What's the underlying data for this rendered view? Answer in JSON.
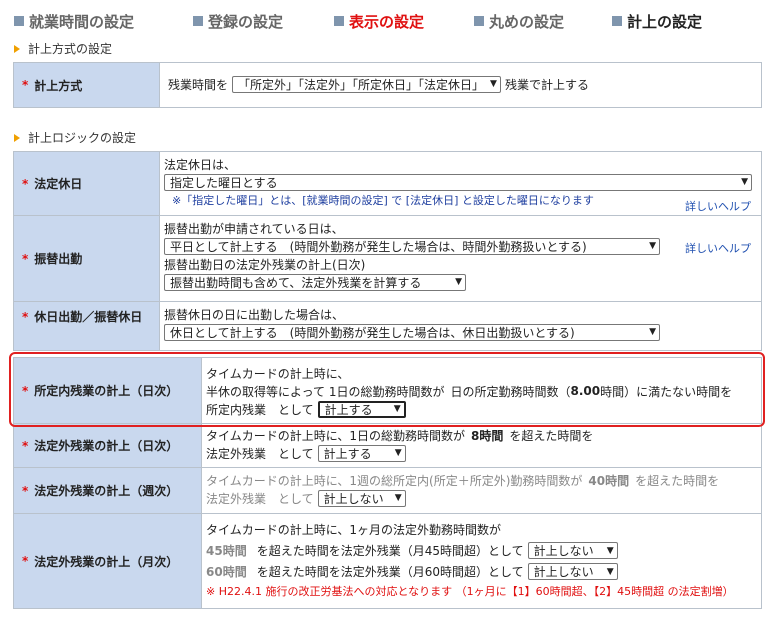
{
  "tabs": [
    {
      "label": "就業時間の設定"
    },
    {
      "label": "登録の設定"
    },
    {
      "label": "表示の設定"
    },
    {
      "label": "丸めの設定"
    },
    {
      "label": "計上の設定"
    }
  ],
  "sections": {
    "method": "計上方式の設定",
    "logic": "計上ロジックの設定"
  },
  "method_row": {
    "label": "計上方式",
    "prefix": "残業時間を",
    "select_value": "「所定外」「法定外」「所定休日」「法定休日」",
    "suffix": "残業で計上する"
  },
  "holiday_row": {
    "label": "法定休日",
    "line1": "法定休日は、",
    "select_value": "指定した曜日とする",
    "note": "※「指定した曜日」とは、[就業時間の設定] で [法定休日] と設定した曜日になります",
    "help": "詳しいヘルプ"
  },
  "substitute_row": {
    "label": "振替出勤",
    "line1": "振替出勤が申請されている日は、",
    "select1": "平日として計上する　(時間外勤務が発生した場合は、時間外勤務扱いとする)",
    "help": "詳しいヘルプ",
    "line2": "振替出勤日の法定外残業の計上(日次)",
    "select2": "振替出勤時間も含めて、法定外残業を計算する"
  },
  "holiday_work_row": {
    "label": "休日出勤／振替休日",
    "line1": "振替休日の日に出勤した場合は、",
    "select_value": "休日として計上する　(時間外勤務が発生した場合は、休日出勤扱いとする)"
  },
  "within_daily_row": {
    "label": "所定内残業の計上（日次）",
    "line1": "タイムカードの計上時に、",
    "line2_a": "半休の取得等によって 1日の総勤務時間数が",
    "line2_b": "日の所定勤務時間数（",
    "line2_hours": "8.00",
    "line2_c": "時間）に満たない時間を",
    "line3_prefix": "所定内残業　として",
    "select_value": "計上する"
  },
  "legal_daily_row": {
    "label": "法定外残業の計上（日次）",
    "line1_a": "タイムカードの計上時に、1日の総勤務時間数が",
    "hours": "8時間",
    "line1_b": "を超えた時間を",
    "line2_prefix": "法定外残業　として",
    "select_value": "計上する"
  },
  "legal_weekly_row": {
    "label": "法定外残業の計上（週次）",
    "line1_a": "タイムカードの計上時に、1週の総所定内(所定＋所定外)勤務時間数が",
    "hours": "40時間",
    "line1_b": "を超えた時間を",
    "line2_prefix": "法定外残業　として",
    "select_value": "計上しない"
  },
  "legal_monthly_row": {
    "label": "法定外残業の計上（月次）",
    "line1": "タイムカードの計上時に、1ヶ月の法定外勤務時間数が",
    "r1_hours": "45時間",
    "r1_text": "を超えた時間を法定外残業（月45時間超）として",
    "r1_select": "計上しない",
    "r2_hours": "60時間",
    "r2_text": "を超えた時間を法定外残業（月60時間超）として",
    "r2_select": "計上しない",
    "note": "※ H22.4.1 施行の改正労基法への対応となります （1ヶ月に【1】60時間超、【2】45時間超 の法定割増）"
  },
  "colors": {
    "active_tab": "#e01010",
    "label_bg": "#c9d8ee",
    "highlight": "#e02020",
    "section_marker": "#f0a000"
  }
}
